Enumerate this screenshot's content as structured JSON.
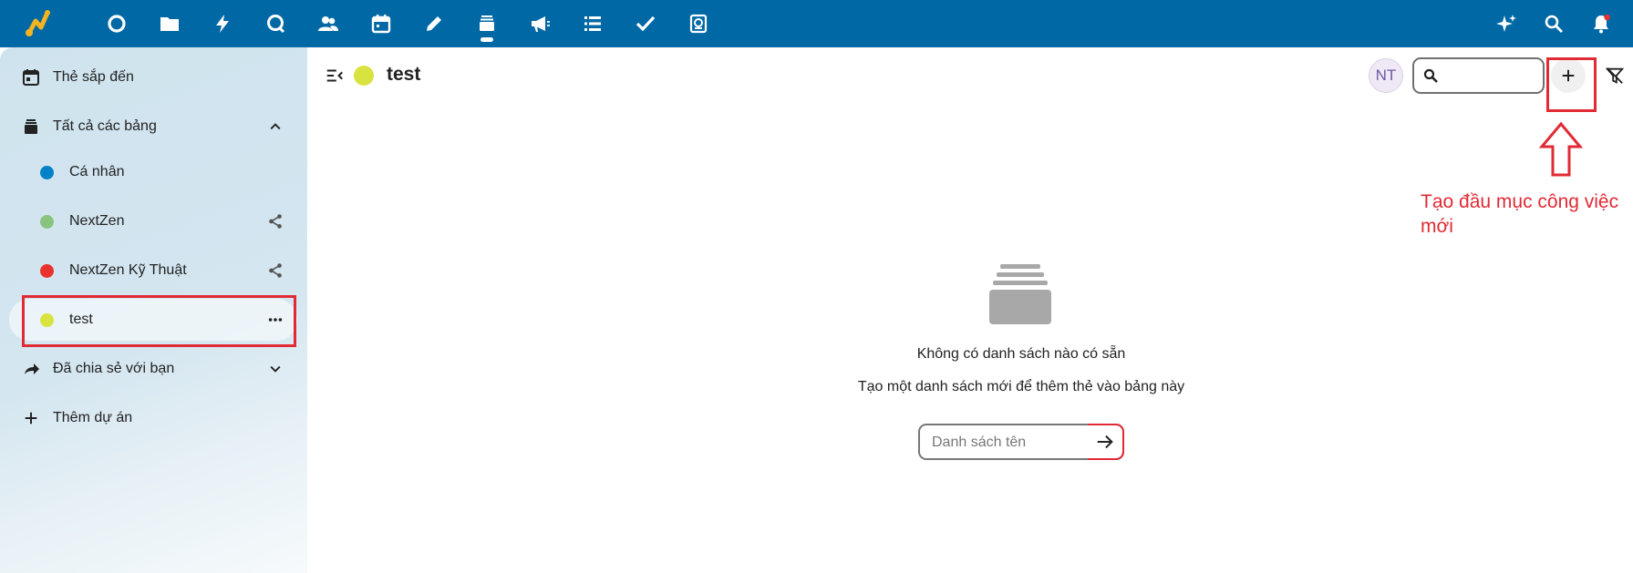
{
  "topbar": {
    "apps": [
      {
        "name": "dashboard-icon",
        "label": "Dashboard"
      },
      {
        "name": "files-icon",
        "label": "Files"
      },
      {
        "name": "activity-icon",
        "label": "Activity"
      },
      {
        "name": "talk-icon",
        "label": "Talk"
      },
      {
        "name": "contacts-icon",
        "label": "Contacts"
      },
      {
        "name": "calendar-icon",
        "label": "Calendar"
      },
      {
        "name": "notes-icon",
        "label": "Notes"
      },
      {
        "name": "deck-icon",
        "label": "Deck"
      },
      {
        "name": "announcements-icon",
        "label": "Announcements"
      },
      {
        "name": "list-icon",
        "label": "List"
      },
      {
        "name": "tasks-icon",
        "label": "Tasks"
      },
      {
        "name": "forms-icon",
        "label": "Forms"
      }
    ],
    "right_icons": [
      "assistant-sparkle-icon",
      "search-icon",
      "notifications-bell-icon"
    ]
  },
  "sidebar": {
    "upcoming": "Thẻ sắp đến",
    "all_boards": "Tất cả các bảng",
    "boards": [
      {
        "label": "Cá nhân",
        "color": "#0082c9",
        "shared": false
      },
      {
        "label": "NextZen",
        "color": "#89c47f",
        "shared": true
      },
      {
        "label": "NextZen Kỹ Thuật",
        "color": "#e9322d",
        "shared": true
      },
      {
        "label": "test",
        "color": "#d9e33f",
        "shared": false
      }
    ],
    "shared_with_you": "Đã chia sẻ với bạn",
    "add_project": "Thêm dự án"
  },
  "header": {
    "board_title": "test",
    "board_color": "#d9e33f",
    "avatar_initials": "NT",
    "search_placeholder": ""
  },
  "annotation": {
    "text": "Tạo đầu mục công việc mới",
    "color": "#e12a34"
  },
  "empty_state": {
    "title": "Không có danh sách nào có sẵn",
    "description": "Tạo một danh sách mới để thêm thẻ vào bảng này",
    "input_placeholder": "Danh sách tên"
  },
  "colors": {
    "topbar": "#0068a4",
    "highlight": "#e12a34"
  }
}
